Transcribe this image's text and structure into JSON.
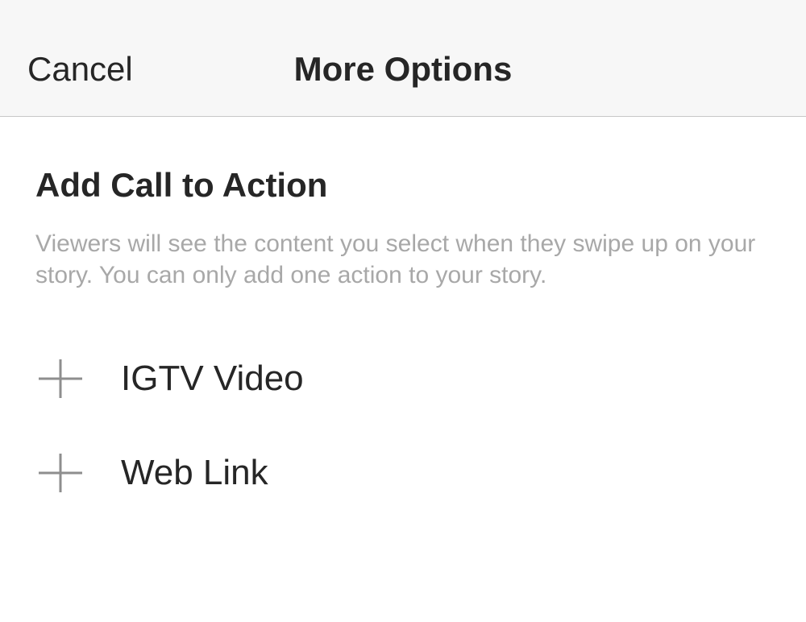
{
  "header": {
    "cancel_label": "Cancel",
    "title": "More Options"
  },
  "section": {
    "heading": "Add Call to Action",
    "description": "Viewers will see the content you select when they swipe up on your story. You can only add one action to your story."
  },
  "options": [
    {
      "label": "IGTV Video",
      "icon": "plus-icon"
    },
    {
      "label": "Web Link",
      "icon": "plus-icon"
    }
  ],
  "colors": {
    "text_primary": "#262626",
    "text_secondary": "#a8a8a8",
    "nav_background": "#f7f7f7",
    "divider": "#c7c7c7",
    "icon": "#8e8e8e"
  }
}
